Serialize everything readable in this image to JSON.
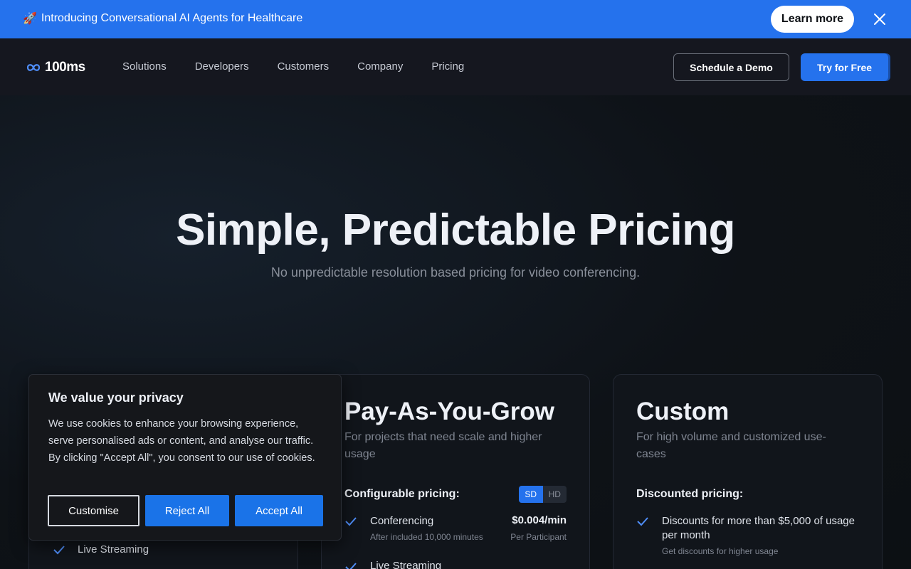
{
  "announcement": {
    "icon": "rocket-icon",
    "text": "Introducing Conversational AI Agents for Healthcare",
    "cta_label": "Learn more",
    "accent": "#2572ed"
  },
  "nav": {
    "logo_text": "100ms",
    "links": [
      "Solutions",
      "Developers",
      "Customers",
      "Company",
      "Pricing"
    ],
    "demo_label": "Schedule a Demo",
    "try_label": "Try for Free"
  },
  "hero": {
    "title": "Simple, Predictable Pricing",
    "subtitle": "No unpredictable resolution based pricing for video conferencing."
  },
  "plans": {
    "left": {
      "feature_visible": "Live Streaming"
    },
    "payg": {
      "title": "Pay-As-You-Grow",
      "description": "For projects that need scale and higher usage",
      "label": "Configurable pricing:",
      "toggle": [
        "SD",
        "HD"
      ],
      "toggle_selected": "SD",
      "features": [
        {
          "name": "Conferencing",
          "sub": "After included 10,000 minutes",
          "price": "$0.004/min",
          "price_sub": "Per Participant"
        },
        {
          "name": "Live Streaming",
          "sub": "",
          "price": "",
          "price_sub": ""
        }
      ]
    },
    "custom": {
      "title": "Custom",
      "description": "For high volume and customized use-cases",
      "label": "Discounted pricing:",
      "features": [
        {
          "name": "Discounts for more than $5,000 of usage per month",
          "sub": "Get discounts for higher usage"
        }
      ]
    }
  },
  "cookie": {
    "title": "We value your privacy",
    "body": "We use cookies to enhance your browsing experience, serve personalised ads or content, and analyse our traffic. By clicking \"Accept All\", you consent to our use of cookies.",
    "customise_label": "Customise",
    "reject_label": "Reject All",
    "accept_label": "Accept All"
  }
}
